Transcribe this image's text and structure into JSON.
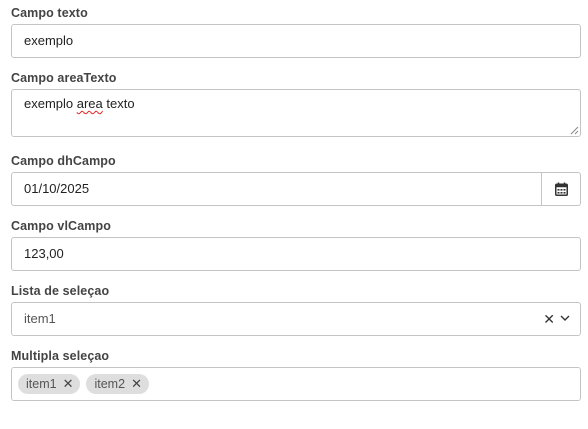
{
  "fields": {
    "campo_texto": {
      "label": "Campo texto",
      "value": "exemplo"
    },
    "campo_area_texto": {
      "label": "Campo areaTexto",
      "value_before": "exemplo ",
      "value_misspelled": "area",
      "value_after": " texto"
    },
    "campo_dh": {
      "label": "Campo dhCampo",
      "value": "01/10/2025",
      "button_icon": "calendar-icon"
    },
    "campo_vl": {
      "label": "Campo vlCampo",
      "value": "123,00"
    },
    "lista_selecao": {
      "label": "Lista de seleçao",
      "selected": "item1",
      "clear_glyph": "✕",
      "chevron_icon": "chevron-down-icon"
    },
    "multipla_selecao": {
      "label": "Multipla seleçao",
      "tags": [
        {
          "label": "item1",
          "remove_glyph": "✕"
        },
        {
          "label": "item2",
          "remove_glyph": "✕"
        }
      ]
    }
  },
  "colors": {
    "border": "#c4c4c4",
    "label": "#444444",
    "tag_background": "#dedede",
    "spellcheck": "#e02020"
  }
}
